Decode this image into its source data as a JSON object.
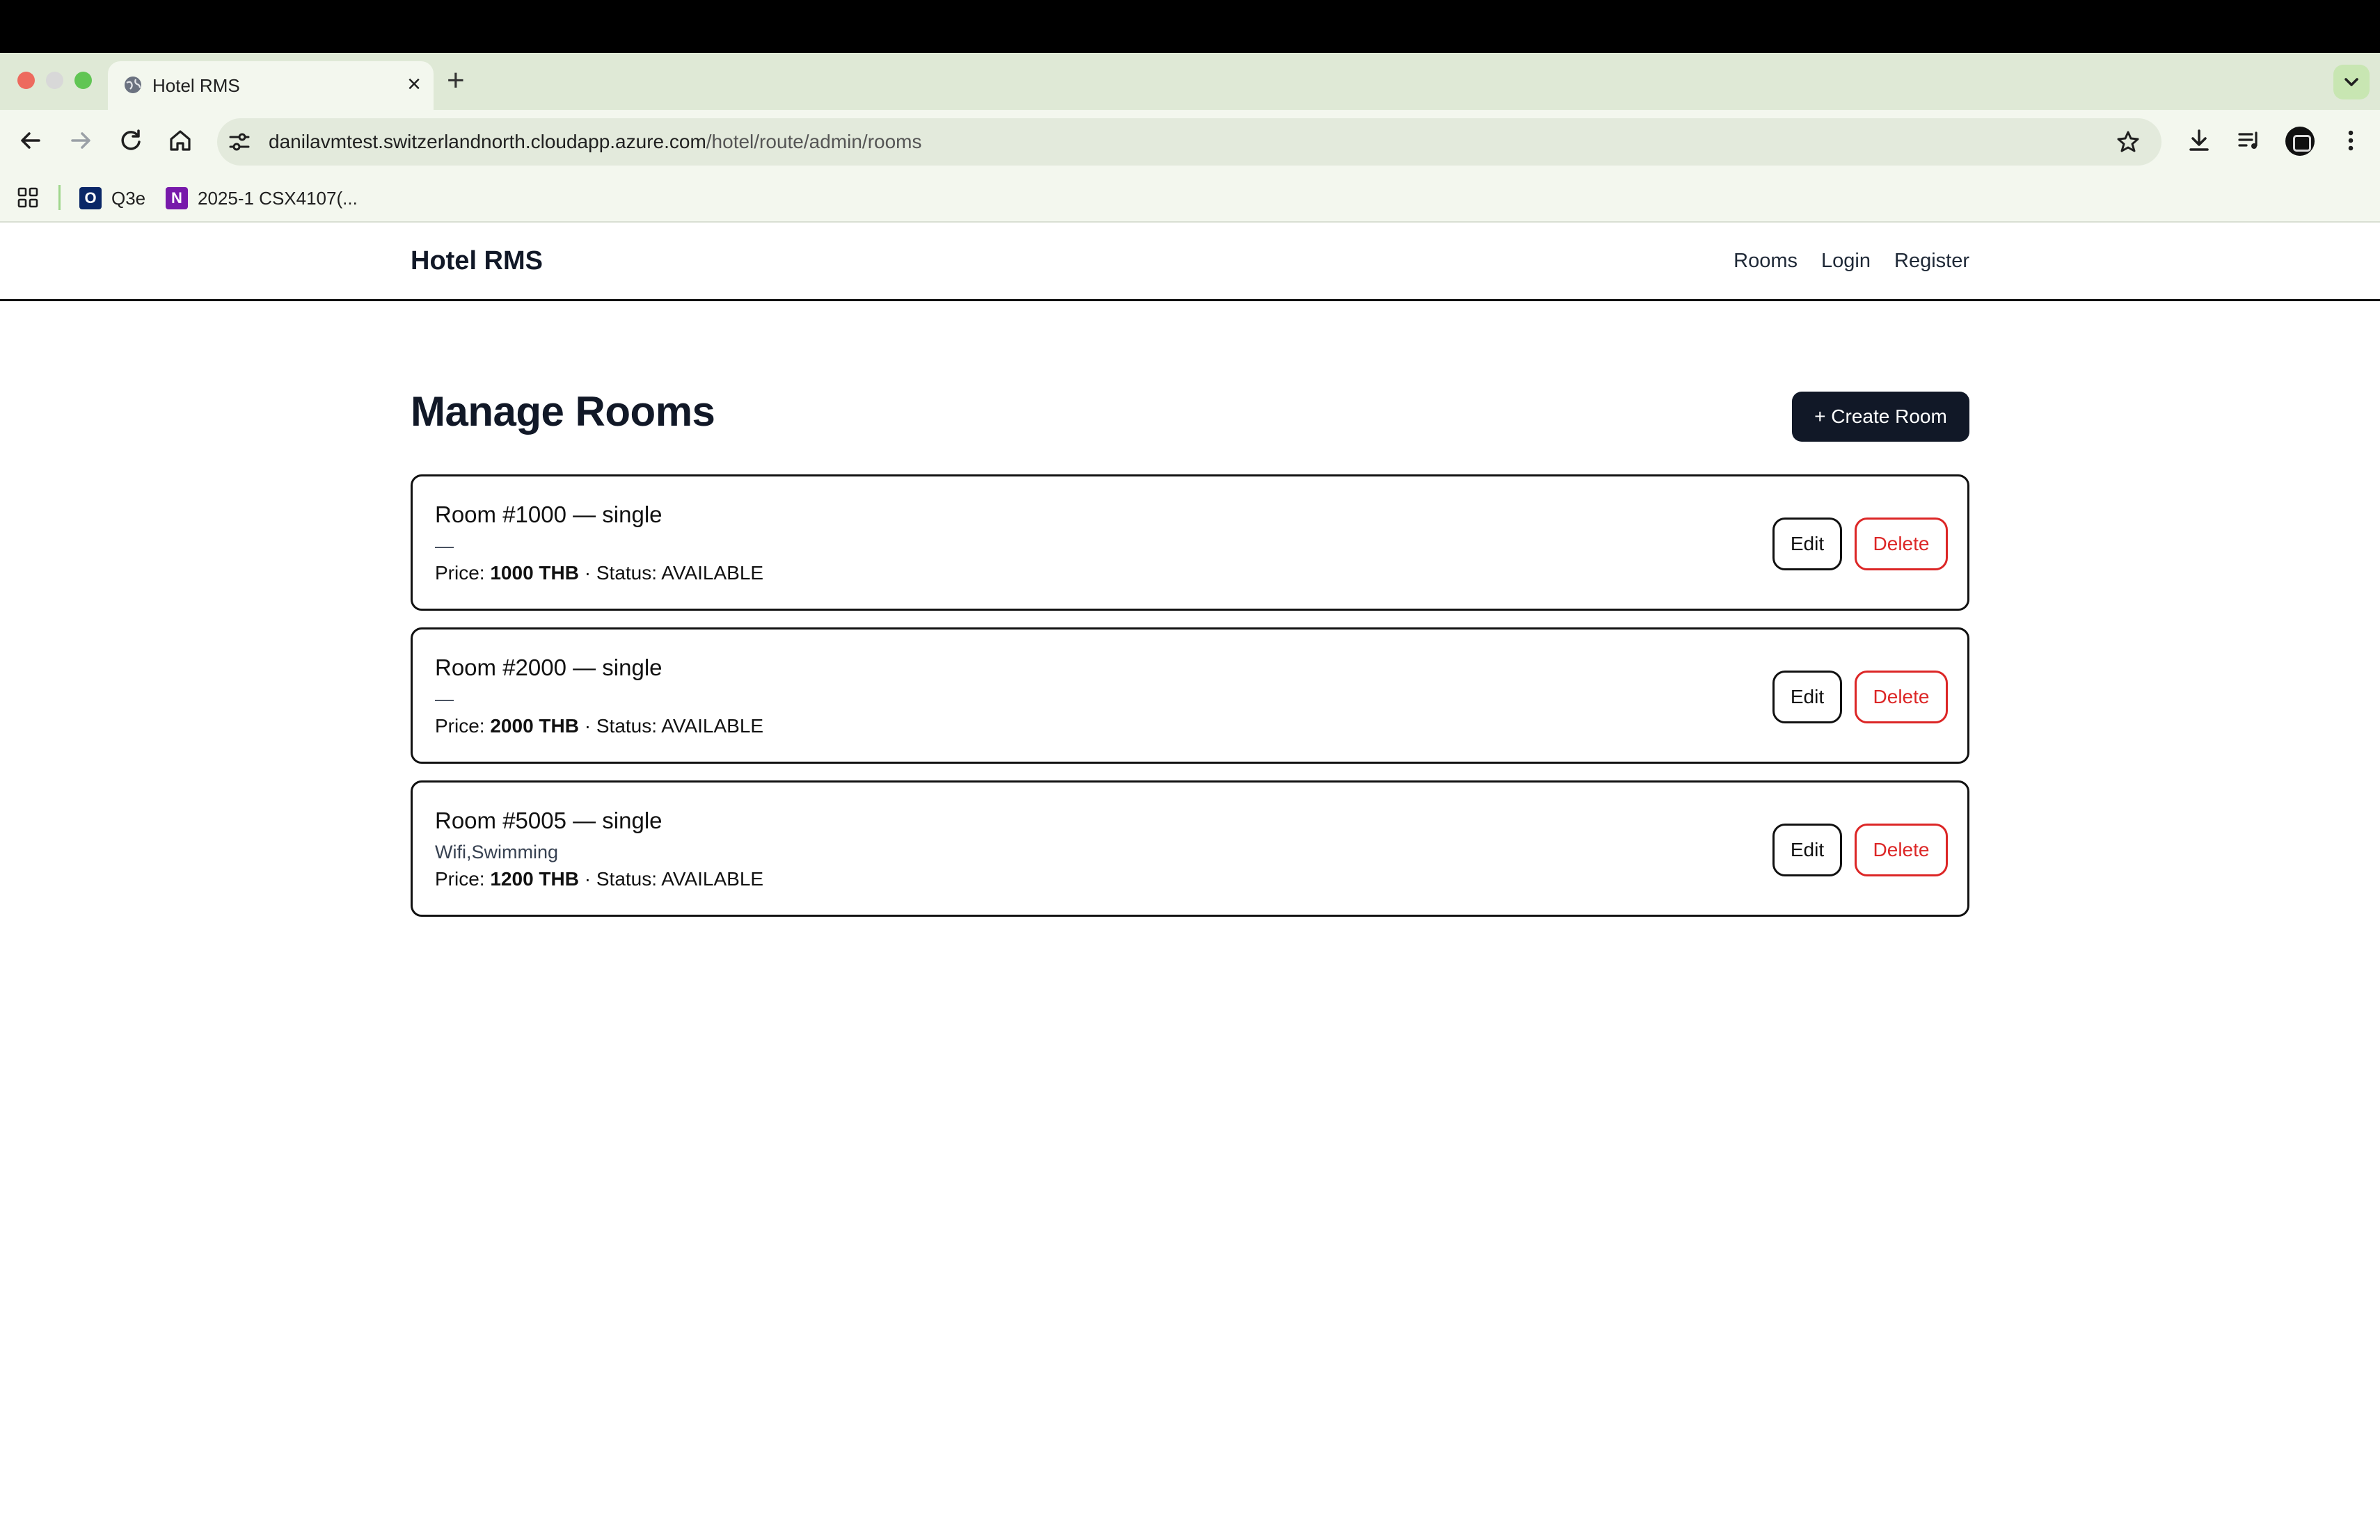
{
  "browser": {
    "tab_title": "Hotel RMS",
    "new_tab_symbol": "+",
    "close_symbol": "×",
    "url_host": "danilavmtest.switzerlandnorth.cloudapp.azure.com",
    "url_path": "/hotel/route/admin/rooms",
    "bookmarks": [
      {
        "label": "Q3e",
        "icon": "outlook-icon",
        "icon_text": "O",
        "icon_color": "#0a2767"
      },
      {
        "label": "2025-1 CSX4107(...",
        "icon": "onenote-icon",
        "icon_text": "N",
        "icon_color": "#7719aa"
      }
    ]
  },
  "app": {
    "brand": "Hotel RMS",
    "nav": [
      "Rooms",
      "Login",
      "Register"
    ],
    "page_title": "Manage Rooms",
    "create_button": "+ Create Room",
    "edit_label": "Edit",
    "delete_label": "Delete",
    "price_label": "Price:",
    "status_label": "· Status:",
    "rooms": [
      {
        "title": "Room #1000 — single",
        "amenities": "—",
        "price": "1000 THB",
        "status": "AVAILABLE"
      },
      {
        "title": "Room #2000 — single",
        "amenities": "—",
        "price": "2000 THB",
        "status": "AVAILABLE"
      },
      {
        "title": "Room #5005 — single",
        "amenities": "Wifi,Swimming",
        "price": "1200 THB",
        "status": "AVAILABLE"
      }
    ]
  },
  "colors": {
    "primary_button": "#111827",
    "delete": "#dc2626",
    "tabstrip": "#dfe9d6"
  }
}
